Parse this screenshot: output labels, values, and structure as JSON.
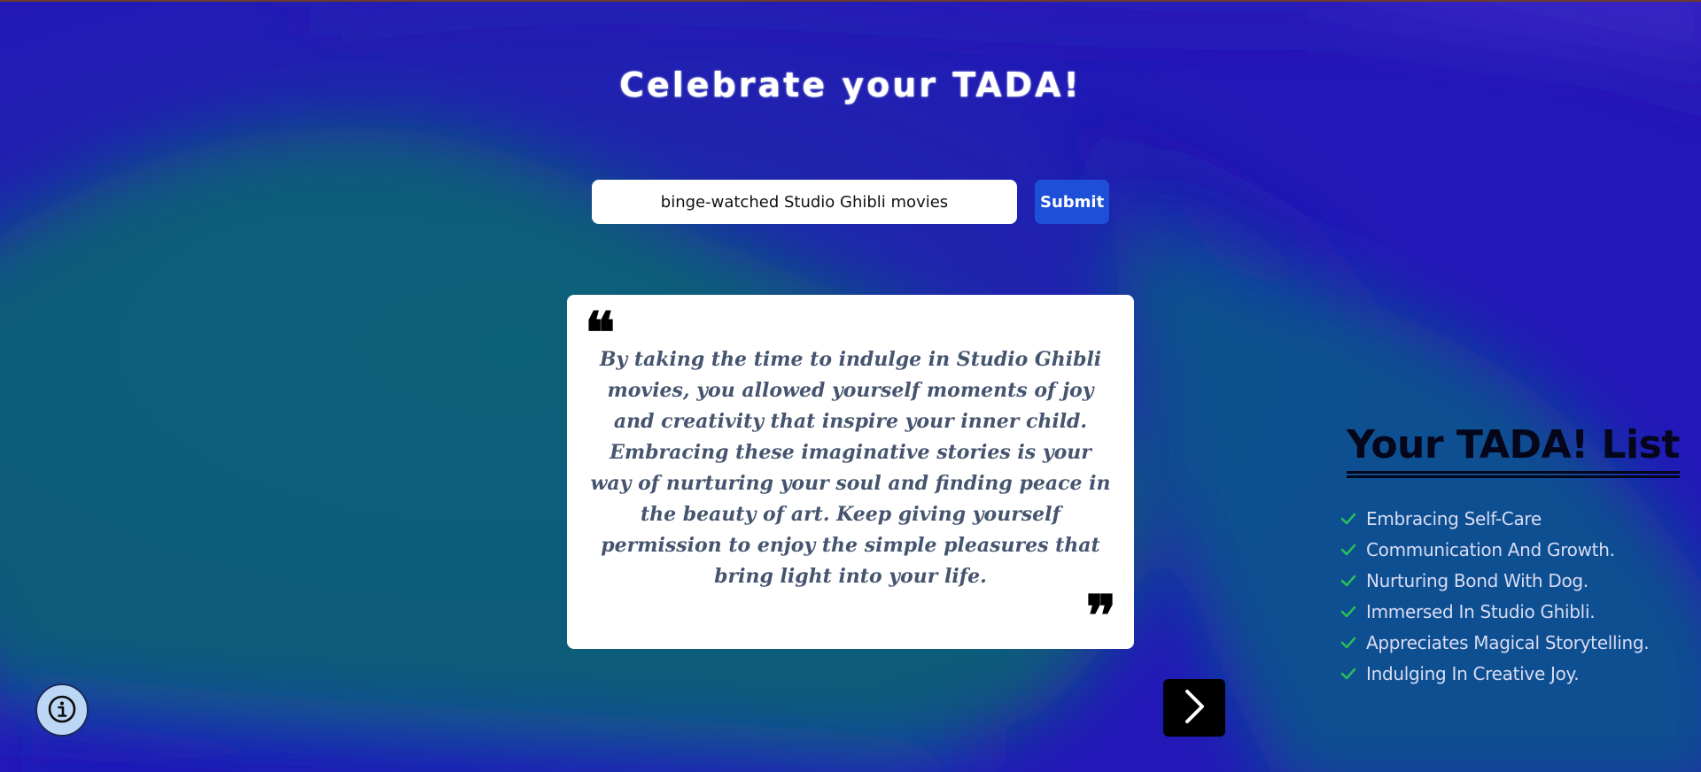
{
  "header": {
    "title": "Celebrate your TADA!"
  },
  "form": {
    "input_value": "binge-watched Studio Ghibli movies",
    "submit_label": "Submit"
  },
  "quote": {
    "open_mark": "❝",
    "close_mark": "❞",
    "text": "By taking the time to indulge in Studio Ghibli movies, you allowed yourself moments of joy and creativity that inspire your inner child. Embracing these imaginative stories is your way of nurturing your soul and finding peace in the beauty of art. Keep giving yourself permission to enjoy the simple pleasures that bring light into your life."
  },
  "tada_list": {
    "heading": "Your TADA! List",
    "items": [
      "Embracing Self-Care",
      "Communication And Growth.",
      "Nurturing Bond With Dog.",
      "Immersed In Studio Ghibli.",
      "Appreciates Magical Storytelling.",
      "Indulging In Creative Joy."
    ]
  },
  "icons": {
    "next": "chevron-right-icon",
    "info": "info-icon",
    "check": "check-icon"
  },
  "colors": {
    "background_blue": "#2318b8",
    "background_teal": "#0a5a78",
    "submit_button": "#1d4fd8",
    "check_green": "#2bbf5a",
    "quote_text": "#46556f",
    "next_button": "#000000",
    "info_button": "#bcd6f6"
  }
}
